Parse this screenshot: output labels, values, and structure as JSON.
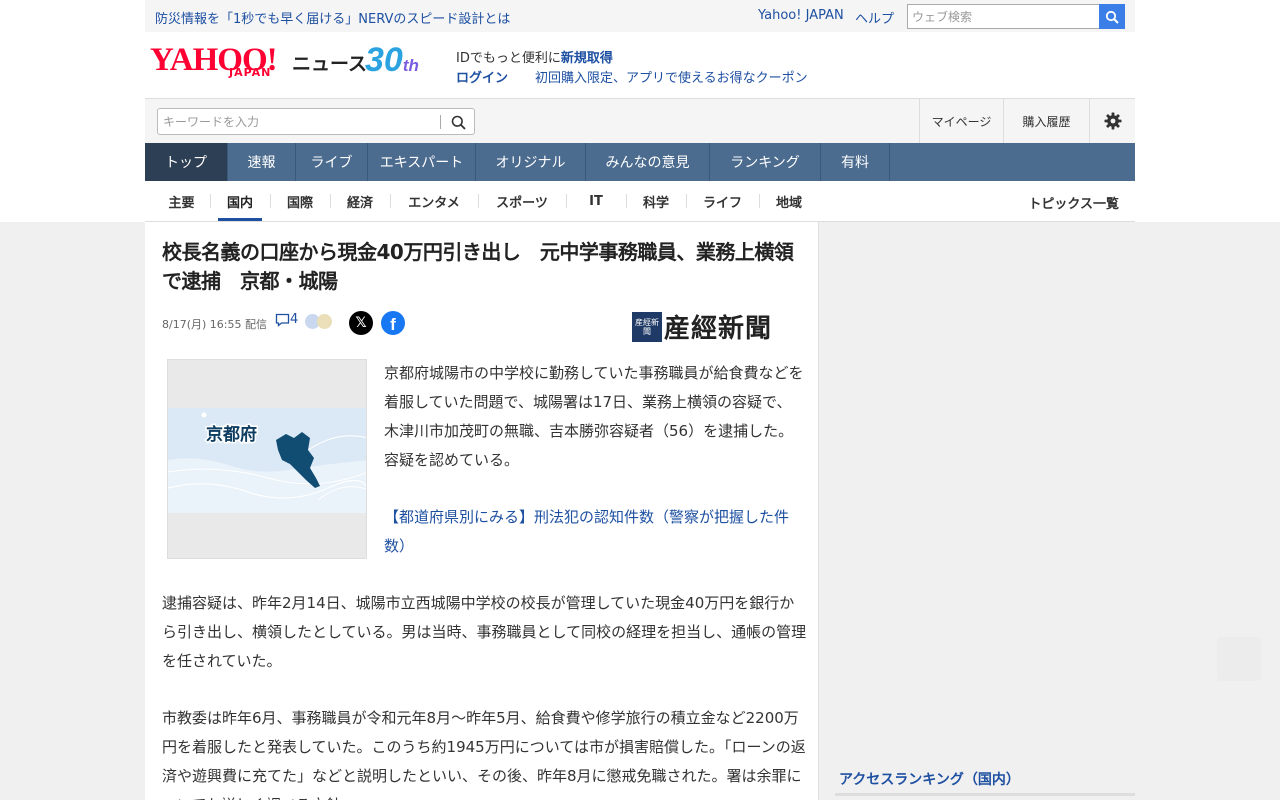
{
  "promo": {
    "link": "防災情報を「1秒でも早く届ける」NERVのスピード設計とは",
    "yahoo_japan": "Yahoo! JAPAN",
    "help": "ヘルプ",
    "web_search_placeholder": "ウェブ検索"
  },
  "header": {
    "logo": "YAHOO!",
    "logo_sub": "JAPAN",
    "section": "ニュース",
    "anniversary_num": "30",
    "anniversary_suffix": "th",
    "id_prefix": "IDでもっと便利に",
    "id_signup": "新規取得",
    "login": "ログイン",
    "coupon": "初回購入限定、アプリで使えるお得なクーポン"
  },
  "search": {
    "placeholder": "キーワードを入力",
    "mypage": "マイページ",
    "purchase_history": "購入履歴"
  },
  "main_nav": [
    "トップ",
    "速報",
    "ライブ",
    "エキスパート",
    "オリジナル",
    "みんなの意見",
    "ランキング",
    "有料"
  ],
  "sub_nav": [
    "主要",
    "国内",
    "国際",
    "経済",
    "エンタメ",
    "スポーツ",
    "IT",
    "科学",
    "ライフ",
    "地域"
  ],
  "sub_nav_active": "国内",
  "topics_list": "トピックス一覧",
  "article": {
    "title": "校長名義の口座から現金40万円引き出し　元中学事務職員、業務上横領で逮捕　京都・城陽",
    "date": "8/17(月) 16:55",
    "delivered": "配信",
    "comment_count": "4",
    "x_icon": "𝕏",
    "fb_icon": "f",
    "publisher": "産經新聞",
    "publisher_badge": "産經新聞",
    "map_label": "京都府",
    "lead": "京都府城陽市の中学校に勤務していた事務職員が給食費などを着服していた問題で、城陽署は17日、業務上横領の容疑で、木津川市加茂町の無職、吉本勝弥容疑者（56）を逮捕した。容疑を認めている。",
    "related_link": "【都道府県別にみる】刑法犯の認知件数（警察が把握した件数）",
    "para1": "逮捕容疑は、昨年2月14日、城陽市立西城陽中学校の校長が管理していた現金40万円を銀行から引き出し、横領したとしている。男は当時、事務職員として同校の経理を担当し、通帳の管理を任されていた。",
    "para2": "市教委は昨年6月、事務職員が令和元年8月～昨年5月、給食費や修学旅行の積立金など2200万円を着服したと発表していた。このうち約1945万円については市が損害賠償した。「ローンの返済や遊興費に充てた」などと説明したといい、その後、昨年8月に懲戒免職された。署は余罪についても詳しく調べる方針。"
  },
  "sidebar": {
    "access_ranking": "アクセスランキング（国内）"
  },
  "colors": {
    "link": "#1e50a2",
    "nav_bg": "#4b6b8f",
    "nav_active": "#2d3f54",
    "logo_red": "#ff0033",
    "search_btn": "#3b7ee8"
  }
}
